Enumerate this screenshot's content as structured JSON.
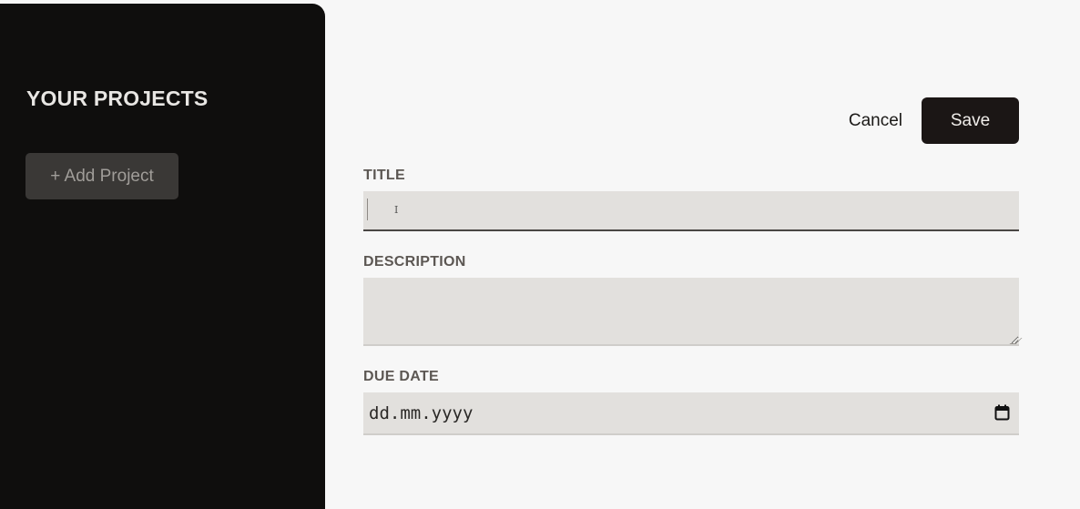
{
  "sidebar": {
    "title": "YOUR PROJECTS",
    "add_button_label": "+ Add Project"
  },
  "toolbar": {
    "cancel_label": "Cancel",
    "save_label": "Save"
  },
  "form": {
    "title_label": "TITLE",
    "title_value": "",
    "description_label": "DESCRIPTION",
    "description_value": "",
    "due_date_label": "DUE DATE",
    "due_date_placeholder": "dd.mm.yyyy"
  },
  "icons": {
    "text_cursor": "ibeam-icon",
    "calendar": "calendar-icon"
  },
  "colors": {
    "sidebar_bg": "#0f0e0d",
    "page_bg": "#f7f7f7",
    "save_bg": "#1b1615",
    "input_bg": "#e2e0dd"
  }
}
